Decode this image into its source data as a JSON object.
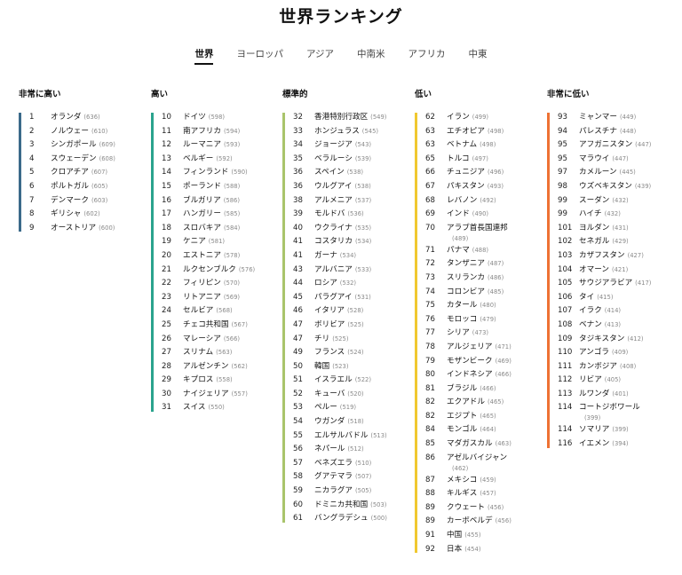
{
  "title": "世界ランキング",
  "tabs": [
    {
      "label": "世界",
      "active": true
    },
    {
      "label": "ヨーロッパ",
      "active": false
    },
    {
      "label": "アジア",
      "active": false
    },
    {
      "label": "中南米",
      "active": false
    },
    {
      "label": "アフリカ",
      "active": false
    },
    {
      "label": "中東",
      "active": false
    }
  ],
  "colors": {
    "very_high": "#3b6a8a",
    "high": "#2aa38d",
    "moderate": "#a9c46b",
    "low": "#f0c830",
    "very_low": "#ee7234"
  },
  "columns": [
    {
      "title": "非常に高い",
      "color": "#3b6a8a",
      "items": [
        {
          "rank": "1",
          "name": "オランダ",
          "score": "(636)"
        },
        {
          "rank": "2",
          "name": "ノルウェー",
          "score": "(610)"
        },
        {
          "rank": "3",
          "name": "シンガポール",
          "score": "(609)"
        },
        {
          "rank": "4",
          "name": "スウェーデン",
          "score": "(608)"
        },
        {
          "rank": "5",
          "name": "クロアチア",
          "score": "(607)"
        },
        {
          "rank": "6",
          "name": "ポルトガル",
          "score": "(605)"
        },
        {
          "rank": "7",
          "name": "デンマーク",
          "score": "(603)"
        },
        {
          "rank": "8",
          "name": "ギリシャ",
          "score": "(602)"
        },
        {
          "rank": "9",
          "name": "オーストリア",
          "score": "(600)"
        }
      ]
    },
    {
      "title": "高い",
      "color": "#2aa38d",
      "items": [
        {
          "rank": "10",
          "name": "ドイツ",
          "score": "(598)"
        },
        {
          "rank": "11",
          "name": "南アフリカ",
          "score": "(594)"
        },
        {
          "rank": "12",
          "name": "ルーマニア",
          "score": "(593)"
        },
        {
          "rank": "13",
          "name": "ベルギー",
          "score": "(592)"
        },
        {
          "rank": "14",
          "name": "フィンランド",
          "score": "(590)"
        },
        {
          "rank": "15",
          "name": "ポーランド",
          "score": "(588)"
        },
        {
          "rank": "16",
          "name": "ブルガリア",
          "score": "(586)"
        },
        {
          "rank": "17",
          "name": "ハンガリー",
          "score": "(585)"
        },
        {
          "rank": "18",
          "name": "スロバキア",
          "score": "(584)"
        },
        {
          "rank": "19",
          "name": "ケニア",
          "score": "(581)"
        },
        {
          "rank": "20",
          "name": "エストニア",
          "score": "(578)"
        },
        {
          "rank": "21",
          "name": "ルクセンブルク",
          "score": "(576)"
        },
        {
          "rank": "22",
          "name": "フィリピン",
          "score": "(570)"
        },
        {
          "rank": "23",
          "name": "リトアニア",
          "score": "(569)"
        },
        {
          "rank": "24",
          "name": "セルビア",
          "score": "(568)"
        },
        {
          "rank": "25",
          "name": "チェコ共和国",
          "score": "(567)"
        },
        {
          "rank": "26",
          "name": "マレーシア",
          "score": "(566)"
        },
        {
          "rank": "27",
          "name": "スリナム",
          "score": "(563)"
        },
        {
          "rank": "28",
          "name": "アルゼンチン",
          "score": "(562)"
        },
        {
          "rank": "29",
          "name": "キプロス",
          "score": "(558)"
        },
        {
          "rank": "30",
          "name": "ナイジェリア",
          "score": "(557)"
        },
        {
          "rank": "31",
          "name": "スイス",
          "score": "(550)"
        }
      ]
    },
    {
      "title": "標準的",
      "color": "#a9c46b",
      "items": [
        {
          "rank": "32",
          "name": "香港特別行政区",
          "score": "(549)"
        },
        {
          "rank": "33",
          "name": "ホンジュラス",
          "score": "(545)"
        },
        {
          "rank": "34",
          "name": "ジョージア",
          "score": "(543)"
        },
        {
          "rank": "35",
          "name": "ベラルーシ",
          "score": "(539)"
        },
        {
          "rank": "36",
          "name": "スペイン",
          "score": "(538)"
        },
        {
          "rank": "36",
          "name": "ウルグアイ",
          "score": "(538)"
        },
        {
          "rank": "38",
          "name": "アルメニア",
          "score": "(537)"
        },
        {
          "rank": "39",
          "name": "モルドバ",
          "score": "(536)"
        },
        {
          "rank": "40",
          "name": "ウクライナ",
          "score": "(535)"
        },
        {
          "rank": "41",
          "name": "コスタリカ",
          "score": "(534)"
        },
        {
          "rank": "41",
          "name": "ガーナ",
          "score": "(534)"
        },
        {
          "rank": "43",
          "name": "アルバニア",
          "score": "(533)"
        },
        {
          "rank": "44",
          "name": "ロシア",
          "score": "(532)"
        },
        {
          "rank": "45",
          "name": "パラグアイ",
          "score": "(531)"
        },
        {
          "rank": "46",
          "name": "イタリア",
          "score": "(528)"
        },
        {
          "rank": "47",
          "name": "ボリビア",
          "score": "(525)"
        },
        {
          "rank": "47",
          "name": "チリ",
          "score": "(525)"
        },
        {
          "rank": "49",
          "name": "フランス",
          "score": "(524)"
        },
        {
          "rank": "50",
          "name": "韓国",
          "score": "(523)"
        },
        {
          "rank": "51",
          "name": "イスラエル",
          "score": "(522)"
        },
        {
          "rank": "52",
          "name": "キューバ",
          "score": "(520)"
        },
        {
          "rank": "53",
          "name": "ペルー",
          "score": "(519)"
        },
        {
          "rank": "54",
          "name": "ウガンダ",
          "score": "(518)"
        },
        {
          "rank": "55",
          "name": "エルサルバドル",
          "score": "(513)"
        },
        {
          "rank": "56",
          "name": "ネパール",
          "score": "(512)"
        },
        {
          "rank": "57",
          "name": "ベネズエラ",
          "score": "(510)"
        },
        {
          "rank": "58",
          "name": "グアテマラ",
          "score": "(507)"
        },
        {
          "rank": "59",
          "name": "ニカラグア",
          "score": "(505)"
        },
        {
          "rank": "60",
          "name": "ドミニカ共和国",
          "score": "(503)"
        },
        {
          "rank": "61",
          "name": "バングラデシュ",
          "score": "(500)"
        }
      ]
    },
    {
      "title": "低い",
      "color": "#f0c830",
      "items": [
        {
          "rank": "62",
          "name": "イラン",
          "score": "(499)"
        },
        {
          "rank": "63",
          "name": "エチオピア",
          "score": "(498)"
        },
        {
          "rank": "63",
          "name": "ベトナム",
          "score": "(498)"
        },
        {
          "rank": "65",
          "name": "トルコ",
          "score": "(497)"
        },
        {
          "rank": "66",
          "name": "チュニジア",
          "score": "(496)"
        },
        {
          "rank": "67",
          "name": "パキスタン",
          "score": "(493)"
        },
        {
          "rank": "68",
          "name": "レバノン",
          "score": "(492)"
        },
        {
          "rank": "69",
          "name": "インド",
          "score": "(490)"
        },
        {
          "rank": "70",
          "name": "アラブ首長国連邦",
          "score": "(489)",
          "wrap": true
        },
        {
          "rank": "71",
          "name": "パナマ",
          "score": "(488)"
        },
        {
          "rank": "72",
          "name": "タンザニア",
          "score": "(487)"
        },
        {
          "rank": "73",
          "name": "スリランカ",
          "score": "(486)"
        },
        {
          "rank": "74",
          "name": "コロンビア",
          "score": "(485)"
        },
        {
          "rank": "75",
          "name": "カタール",
          "score": "(480)"
        },
        {
          "rank": "76",
          "name": "モロッコ",
          "score": "(479)"
        },
        {
          "rank": "77",
          "name": "シリア",
          "score": "(473)"
        },
        {
          "rank": "78",
          "name": "アルジェリア",
          "score": "(471)"
        },
        {
          "rank": "79",
          "name": "モザンビーク",
          "score": "(469)"
        },
        {
          "rank": "80",
          "name": "インドネシア",
          "score": "(466)"
        },
        {
          "rank": "81",
          "name": "ブラジル",
          "score": "(466)"
        },
        {
          "rank": "82",
          "name": "エクアドル",
          "score": "(465)"
        },
        {
          "rank": "82",
          "name": "エジプト",
          "score": "(465)"
        },
        {
          "rank": "84",
          "name": "モンゴル",
          "score": "(464)"
        },
        {
          "rank": "85",
          "name": "マダガスカル",
          "score": "(463)"
        },
        {
          "rank": "86",
          "name": "アゼルバイジャン",
          "score": "(462)",
          "wrap": true
        },
        {
          "rank": "87",
          "name": "メキシコ",
          "score": "(459)"
        },
        {
          "rank": "88",
          "name": "キルギス",
          "score": "(457)"
        },
        {
          "rank": "89",
          "name": "クウェート",
          "score": "(456)"
        },
        {
          "rank": "89",
          "name": "カーボベルデ",
          "score": "(456)"
        },
        {
          "rank": "91",
          "name": "中国",
          "score": "(455)"
        },
        {
          "rank": "92",
          "name": "日本",
          "score": "(454)"
        }
      ]
    },
    {
      "title": "非常に低い",
      "color": "#ee7234",
      "items": [
        {
          "rank": "93",
          "name": "ミャンマー",
          "score": "(449)"
        },
        {
          "rank": "94",
          "name": "パレスチナ",
          "score": "(448)"
        },
        {
          "rank": "95",
          "name": "アフガニスタン",
          "score": "(447)"
        },
        {
          "rank": "95",
          "name": "マラウイ",
          "score": "(447)"
        },
        {
          "rank": "97",
          "name": "カメルーン",
          "score": "(445)"
        },
        {
          "rank": "98",
          "name": "ウズベキスタン",
          "score": "(439)"
        },
        {
          "rank": "99",
          "name": "スーダン",
          "score": "(432)"
        },
        {
          "rank": "99",
          "name": "ハイチ",
          "score": "(432)"
        },
        {
          "rank": "101",
          "name": "ヨルダン",
          "score": "(431)"
        },
        {
          "rank": "102",
          "name": "セネガル",
          "score": "(429)"
        },
        {
          "rank": "103",
          "name": "カザフスタン",
          "score": "(427)"
        },
        {
          "rank": "104",
          "name": "オマーン",
          "score": "(421)"
        },
        {
          "rank": "105",
          "name": "サウジアラビア",
          "score": "(417)"
        },
        {
          "rank": "106",
          "name": "タイ",
          "score": "(415)"
        },
        {
          "rank": "107",
          "name": "イラク",
          "score": "(414)"
        },
        {
          "rank": "108",
          "name": "ベナン",
          "score": "(413)"
        },
        {
          "rank": "109",
          "name": "タジキスタン",
          "score": "(412)"
        },
        {
          "rank": "110",
          "name": "アンゴラ",
          "score": "(409)"
        },
        {
          "rank": "111",
          "name": "カンボジア",
          "score": "(408)"
        },
        {
          "rank": "112",
          "name": "リビア",
          "score": "(405)"
        },
        {
          "rank": "113",
          "name": "ルワンダ",
          "score": "(401)"
        },
        {
          "rank": "114",
          "name": "コートジボワール",
          "score": "(399)",
          "wrap": true
        },
        {
          "rank": "114",
          "name": "ソマリア",
          "score": "(399)"
        },
        {
          "rank": "116",
          "name": "イエメン",
          "score": "(394)"
        }
      ]
    }
  ]
}
